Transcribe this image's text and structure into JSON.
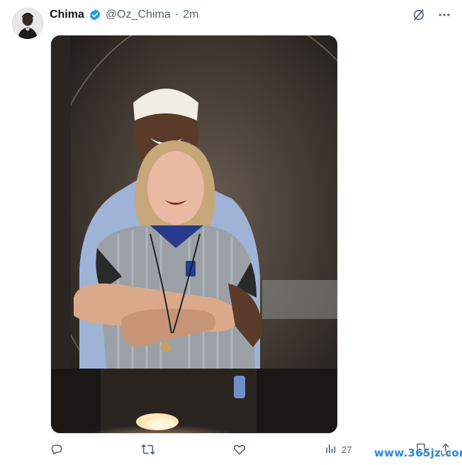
{
  "tweet": {
    "author_name": "Chima",
    "handle": "@Oz_Chima",
    "separator": "·",
    "time": "2m",
    "avatar_icon": "user-avatar",
    "verified_icon": "verified-badge-icon",
    "verified_color": "#1d9bf0"
  },
  "header_actions": [
    {
      "icon": "grok-icon"
    },
    {
      "icon": "more-options-icon"
    }
  ],
  "media": {
    "type": "photo",
    "alt_icon": "tweet-photo"
  },
  "actions": {
    "reply_icon": "reply-icon",
    "retweet_icon": "retweet-icon",
    "like_icon": "heart-icon",
    "views_icon": "views-chart-icon",
    "views_count": "27",
    "bookmark_icon": "bookmark-icon",
    "share_icon": "share-icon"
  },
  "watermark": "www.365jz.com",
  "colors": {
    "text_primary": "#0f1419",
    "text_secondary": "#536471",
    "accent": "#1d9bf0"
  }
}
